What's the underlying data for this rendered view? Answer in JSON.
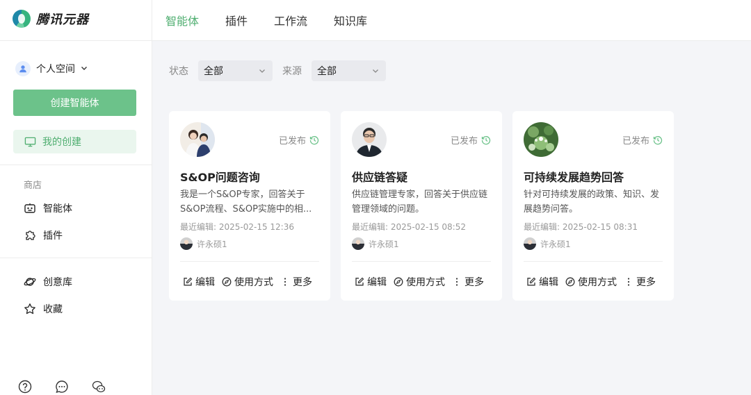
{
  "brand": {
    "name": "腾讯元器"
  },
  "sidebar": {
    "space": "个人空间",
    "create_button": "创建智能体",
    "my_create": "我的创建",
    "store_label": "商店",
    "store_items": [
      "智能体",
      "插件"
    ],
    "extra_items": [
      "创意库",
      "收藏"
    ]
  },
  "tabs": [
    "智能体",
    "插件",
    "工作流",
    "知识库"
  ],
  "active_tab": "智能体",
  "filters": {
    "status_label": "状态",
    "status_value": "全部",
    "source_label": "来源",
    "source_value": "全部"
  },
  "actions": {
    "edit": "编辑",
    "usage": "使用方式",
    "more": "更多"
  },
  "cards": [
    {
      "status": "已发布",
      "title": "S&OP问题咨询",
      "desc": "我是一个S&OP专家，回答关于S&OP流程、S&OP实施中的相...",
      "edited": "最近编辑: 2025-02-15 12:36",
      "author": "许永硕1"
    },
    {
      "status": "已发布",
      "title": "供应链答疑",
      "desc": "供应链管理专家，回答关于供应链管理领域的问题。",
      "edited": "最近编辑: 2025-02-15 08:52",
      "author": "许永硕1"
    },
    {
      "status": "已发布",
      "title": "可持续发展趋势回答",
      "desc": "针对可持续发展的政策、知识、发展趋势问答。",
      "edited": "最近编辑: 2025-02-15 08:31",
      "author": "许永硕1"
    }
  ],
  "colors": {
    "accent": "#4fae70",
    "button": "#6cc28a",
    "active_bg": "#eaf6ee"
  }
}
